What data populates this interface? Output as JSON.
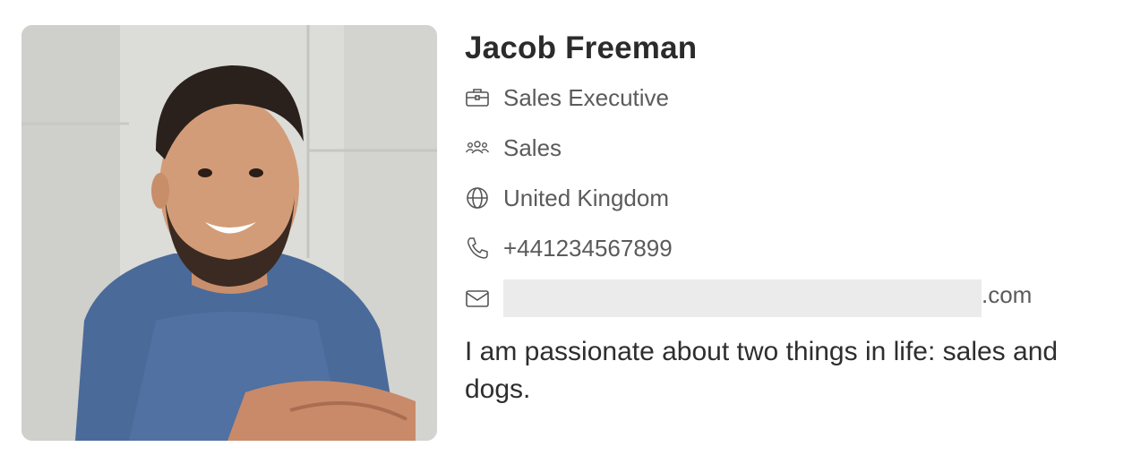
{
  "profile": {
    "name": "Jacob Freeman",
    "photo_alt": "profile-photo",
    "fields": {
      "job_title": {
        "icon": "briefcase-icon",
        "value": "Sales Executive"
      },
      "department": {
        "icon": "people-icon",
        "value": "Sales"
      },
      "location": {
        "icon": "globe-icon",
        "value": "United Kingdom"
      },
      "phone": {
        "icon": "phone-icon",
        "value": "+441234567899"
      },
      "email": {
        "icon": "mail-icon",
        "visible_suffix": ".com"
      }
    },
    "bio": "I am passionate about two things in life: sales and dogs."
  },
  "colors": {
    "name_text": "#2b2b2b",
    "field_text": "#5b5b5b",
    "redaction": "#ebebeb",
    "shirt": "#4a6a9a"
  }
}
